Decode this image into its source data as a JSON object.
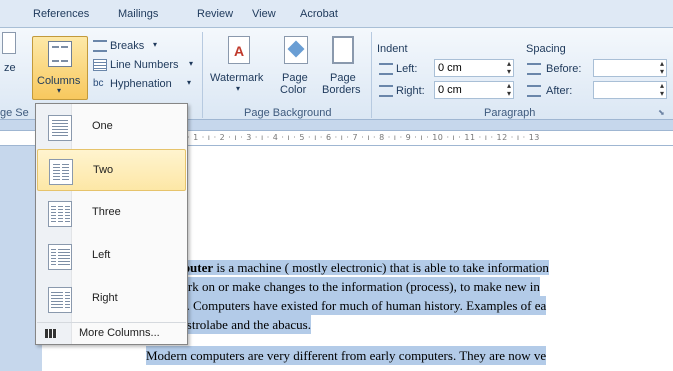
{
  "tabs": [
    "References",
    "Mailings",
    "Review",
    "View",
    "Acrobat"
  ],
  "ribbon": {
    "size_label": "ze",
    "columns_label": "Columns",
    "breaks_label": "Breaks",
    "line_numbers_label": "Line Numbers",
    "hyphenation_label": "Hyphenation",
    "watermark_label": "Watermark",
    "page_color_label_1": "Page",
    "page_color_label_2": "Color",
    "page_borders_label_1": "Page",
    "page_borders_label_2": "Borders",
    "group_page_setup": "ge Se",
    "group_page_background": "Page Background",
    "group_paragraph": "Paragraph",
    "indent_label": "Indent",
    "spacing_label": "Spacing",
    "left_label": "Left:",
    "right_label": "Right:",
    "left_value": "0 cm",
    "right_value": "0 cm",
    "before_label": "Before:",
    "after_label": "After:",
    "before_value": "",
    "after_value": ""
  },
  "ruler": "· 1 · ı · 2 · ı · 3 · ı · 4 · ı · 5 · ı · 6 · ı · 7 · ı · 8 · ı · 9 · ı · 10 · ı · 11 · ı · 12 · ı · 13",
  "menu": {
    "items": [
      "One",
      "Two",
      "Three",
      "Left",
      "Right"
    ],
    "more_label": "More Columns..."
  },
  "document": {
    "line1_bold": "mputer",
    "line1_rest": " is a machine ( mostly electronic) that is able to take information",
    "line2": "work on or make changes to the information (process), to make new in",
    "line3": "nt). Computers have existed for much of human history. Examples of ea",
    "line4": "e astrolabe and the abacus.",
    "line5": "Modern computers are very different from early computers. They are now ve"
  }
}
